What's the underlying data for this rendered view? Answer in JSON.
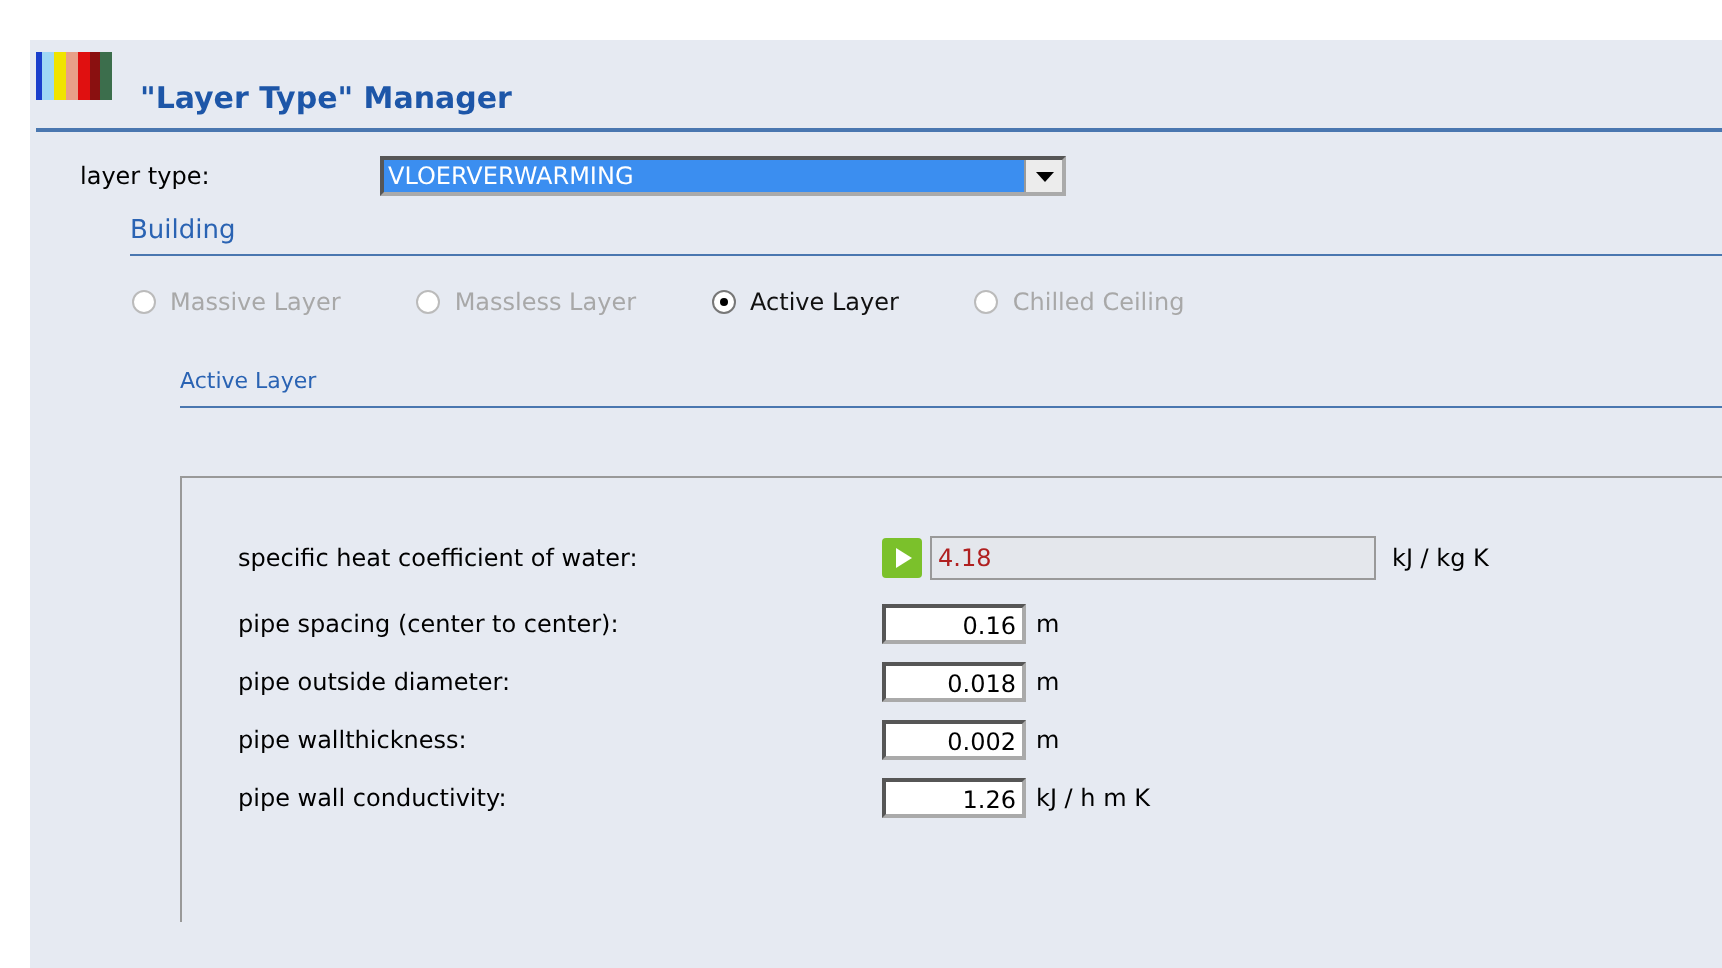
{
  "title": "\"Layer Type\" Manager",
  "layer_type": {
    "label": "layer type:",
    "value": "VLOERVERWARMING"
  },
  "section": "Building",
  "radios": [
    {
      "label": "Massive Layer",
      "selected": false,
      "disabled": true
    },
    {
      "label": "Massless Layer",
      "selected": false,
      "disabled": true
    },
    {
      "label": "Active Layer",
      "selected": true,
      "disabled": false
    },
    {
      "label": "Chilled Ceiling",
      "selected": false,
      "disabled": true
    }
  ],
  "subsection": "Active Layer",
  "fields": [
    {
      "kind": "readonly",
      "label": "specific heat coefficient of water:",
      "value": "4.18",
      "unit": "kJ / kg K"
    },
    {
      "kind": "input",
      "label": "pipe spacing (center to center):",
      "value": "0.16",
      "unit": "m"
    },
    {
      "kind": "input",
      "label": "pipe outside diameter:",
      "value": "0.018",
      "unit": "m"
    },
    {
      "kind": "input",
      "label": "pipe wallthickness:",
      "value": "0.002",
      "unit": "m"
    },
    {
      "kind": "input",
      "label": "pipe wall conductivity:",
      "value": "1.26",
      "unit": "kJ / h m K"
    }
  ]
}
